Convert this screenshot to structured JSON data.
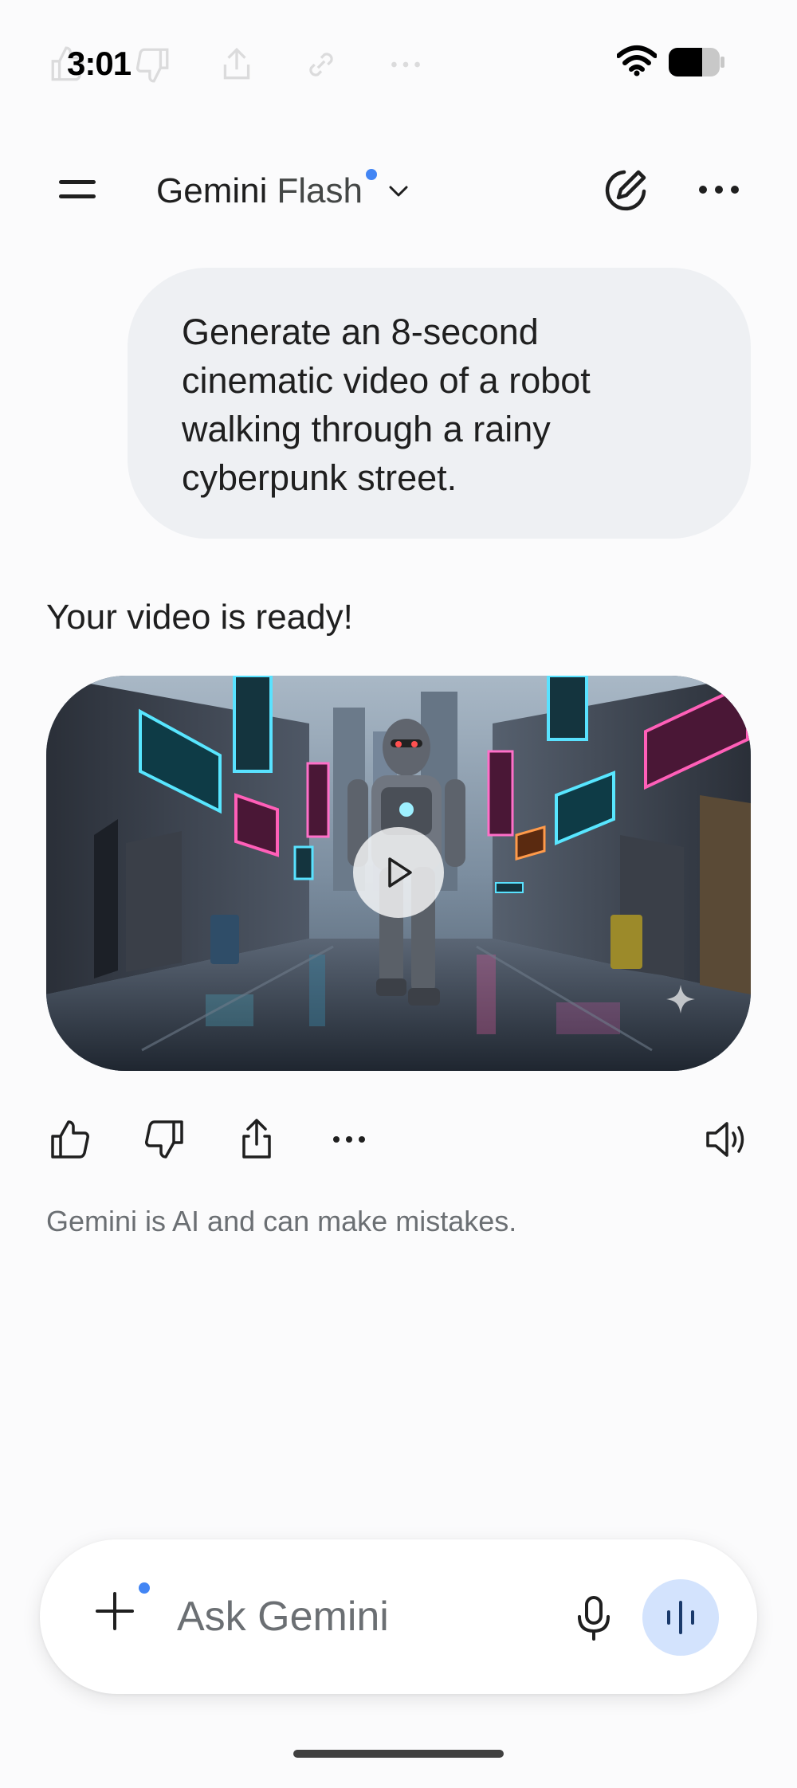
{
  "status_bar": {
    "time": "3:01",
    "wifi_icon": "wifi-icon",
    "battery_icon": "battery-icon"
  },
  "header": {
    "menu_icon": "menu-icon",
    "model_name": "Gemini",
    "model_variant": "Flash",
    "accent_color": "#4285f4",
    "new_chat_icon": "new-chat-icon",
    "more_icon": "more-icon"
  },
  "conversation": {
    "user_prompt": "Generate an 8-second cinematic video of a robot walking through a rainy cyberpunk street.",
    "response_heading": "Your video is ready!",
    "video": {
      "play_icon": "play-icon",
      "sparkle_icon": "sparkle-icon"
    },
    "actions": [
      {
        "name": "thumb-up",
        "icon": "thumb-up-icon"
      },
      {
        "name": "thumb-down",
        "icon": "thumb-down-icon"
      },
      {
        "name": "share",
        "icon": "share-icon"
      },
      {
        "name": "more",
        "icon": "more-icon"
      },
      {
        "name": "read-aloud",
        "icon": "speaker-icon"
      }
    ],
    "disclaimer": "Gemini is AI and can make mistakes."
  },
  "input": {
    "placeholder": "Ask Gemini",
    "value": "",
    "plus_icon": "plus-icon",
    "mic_icon": "mic-icon",
    "live_icon": "live-icon",
    "live_button_color": "#d3e3fd"
  }
}
